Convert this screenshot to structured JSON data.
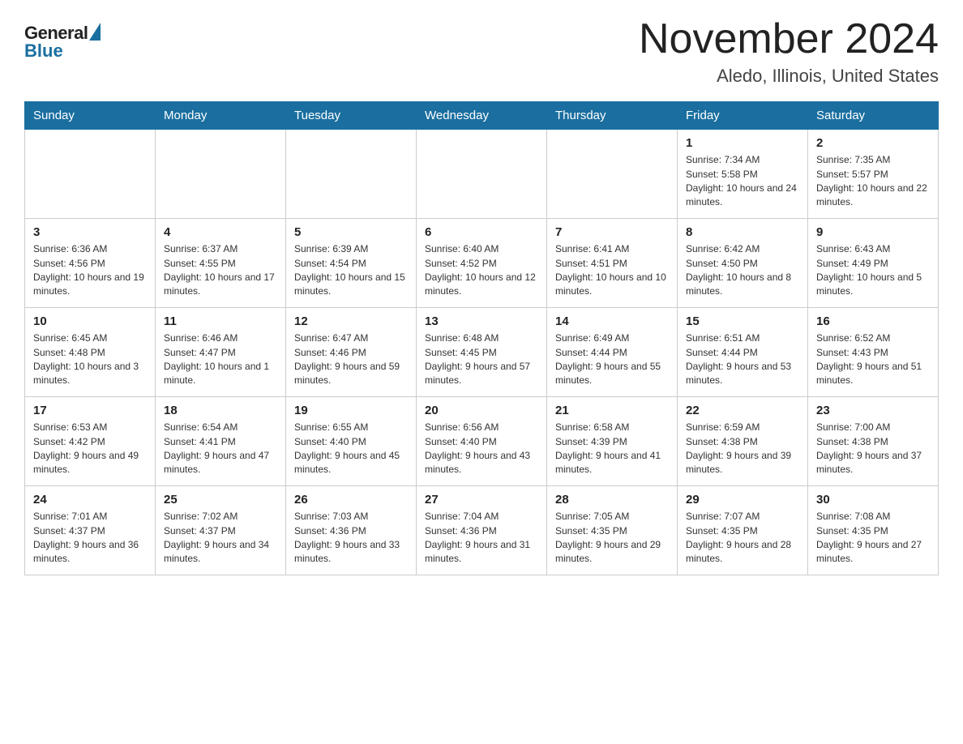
{
  "logo": {
    "general": "General",
    "blue": "Blue"
  },
  "title": "November 2024",
  "location": "Aledo, Illinois, United States",
  "days_of_week": [
    "Sunday",
    "Monday",
    "Tuesday",
    "Wednesday",
    "Thursday",
    "Friday",
    "Saturday"
  ],
  "weeks": [
    [
      {
        "day": "",
        "info": ""
      },
      {
        "day": "",
        "info": ""
      },
      {
        "day": "",
        "info": ""
      },
      {
        "day": "",
        "info": ""
      },
      {
        "day": "",
        "info": ""
      },
      {
        "day": "1",
        "info": "Sunrise: 7:34 AM\nSunset: 5:58 PM\nDaylight: 10 hours and 24 minutes."
      },
      {
        "day": "2",
        "info": "Sunrise: 7:35 AM\nSunset: 5:57 PM\nDaylight: 10 hours and 22 minutes."
      }
    ],
    [
      {
        "day": "3",
        "info": "Sunrise: 6:36 AM\nSunset: 4:56 PM\nDaylight: 10 hours and 19 minutes."
      },
      {
        "day": "4",
        "info": "Sunrise: 6:37 AM\nSunset: 4:55 PM\nDaylight: 10 hours and 17 minutes."
      },
      {
        "day": "5",
        "info": "Sunrise: 6:39 AM\nSunset: 4:54 PM\nDaylight: 10 hours and 15 minutes."
      },
      {
        "day": "6",
        "info": "Sunrise: 6:40 AM\nSunset: 4:52 PM\nDaylight: 10 hours and 12 minutes."
      },
      {
        "day": "7",
        "info": "Sunrise: 6:41 AM\nSunset: 4:51 PM\nDaylight: 10 hours and 10 minutes."
      },
      {
        "day": "8",
        "info": "Sunrise: 6:42 AM\nSunset: 4:50 PM\nDaylight: 10 hours and 8 minutes."
      },
      {
        "day": "9",
        "info": "Sunrise: 6:43 AM\nSunset: 4:49 PM\nDaylight: 10 hours and 5 minutes."
      }
    ],
    [
      {
        "day": "10",
        "info": "Sunrise: 6:45 AM\nSunset: 4:48 PM\nDaylight: 10 hours and 3 minutes."
      },
      {
        "day": "11",
        "info": "Sunrise: 6:46 AM\nSunset: 4:47 PM\nDaylight: 10 hours and 1 minute."
      },
      {
        "day": "12",
        "info": "Sunrise: 6:47 AM\nSunset: 4:46 PM\nDaylight: 9 hours and 59 minutes."
      },
      {
        "day": "13",
        "info": "Sunrise: 6:48 AM\nSunset: 4:45 PM\nDaylight: 9 hours and 57 minutes."
      },
      {
        "day": "14",
        "info": "Sunrise: 6:49 AM\nSunset: 4:44 PM\nDaylight: 9 hours and 55 minutes."
      },
      {
        "day": "15",
        "info": "Sunrise: 6:51 AM\nSunset: 4:44 PM\nDaylight: 9 hours and 53 minutes."
      },
      {
        "day": "16",
        "info": "Sunrise: 6:52 AM\nSunset: 4:43 PM\nDaylight: 9 hours and 51 minutes."
      }
    ],
    [
      {
        "day": "17",
        "info": "Sunrise: 6:53 AM\nSunset: 4:42 PM\nDaylight: 9 hours and 49 minutes."
      },
      {
        "day": "18",
        "info": "Sunrise: 6:54 AM\nSunset: 4:41 PM\nDaylight: 9 hours and 47 minutes."
      },
      {
        "day": "19",
        "info": "Sunrise: 6:55 AM\nSunset: 4:40 PM\nDaylight: 9 hours and 45 minutes."
      },
      {
        "day": "20",
        "info": "Sunrise: 6:56 AM\nSunset: 4:40 PM\nDaylight: 9 hours and 43 minutes."
      },
      {
        "day": "21",
        "info": "Sunrise: 6:58 AM\nSunset: 4:39 PM\nDaylight: 9 hours and 41 minutes."
      },
      {
        "day": "22",
        "info": "Sunrise: 6:59 AM\nSunset: 4:38 PM\nDaylight: 9 hours and 39 minutes."
      },
      {
        "day": "23",
        "info": "Sunrise: 7:00 AM\nSunset: 4:38 PM\nDaylight: 9 hours and 37 minutes."
      }
    ],
    [
      {
        "day": "24",
        "info": "Sunrise: 7:01 AM\nSunset: 4:37 PM\nDaylight: 9 hours and 36 minutes."
      },
      {
        "day": "25",
        "info": "Sunrise: 7:02 AM\nSunset: 4:37 PM\nDaylight: 9 hours and 34 minutes."
      },
      {
        "day": "26",
        "info": "Sunrise: 7:03 AM\nSunset: 4:36 PM\nDaylight: 9 hours and 33 minutes."
      },
      {
        "day": "27",
        "info": "Sunrise: 7:04 AM\nSunset: 4:36 PM\nDaylight: 9 hours and 31 minutes."
      },
      {
        "day": "28",
        "info": "Sunrise: 7:05 AM\nSunset: 4:35 PM\nDaylight: 9 hours and 29 minutes."
      },
      {
        "day": "29",
        "info": "Sunrise: 7:07 AM\nSunset: 4:35 PM\nDaylight: 9 hours and 28 minutes."
      },
      {
        "day": "30",
        "info": "Sunrise: 7:08 AM\nSunset: 4:35 PM\nDaylight: 9 hours and 27 minutes."
      }
    ]
  ]
}
